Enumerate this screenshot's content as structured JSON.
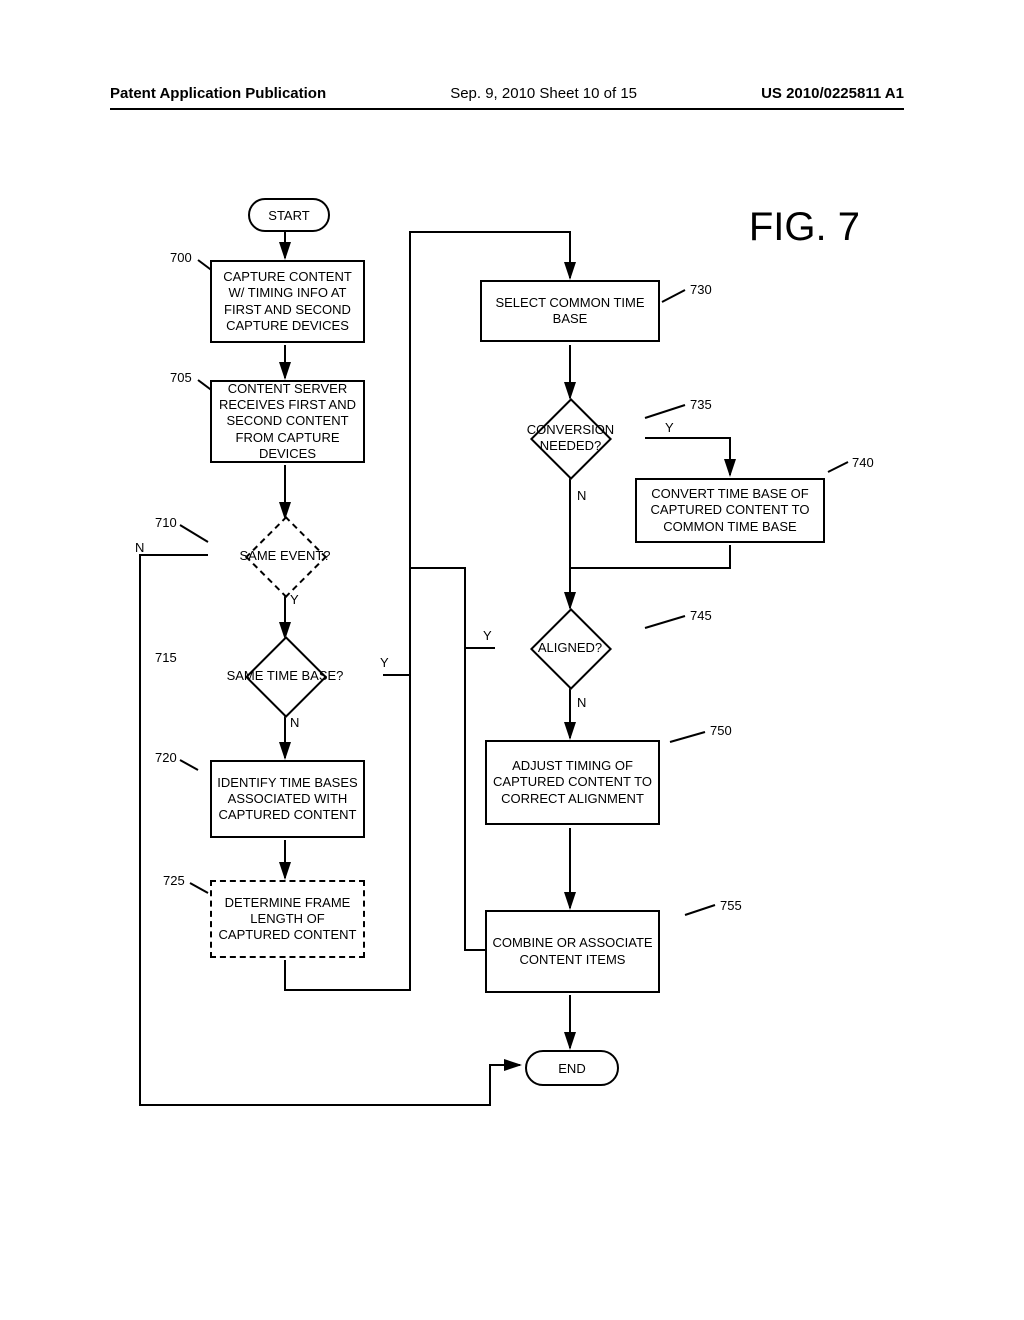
{
  "header": {
    "left": "Patent Application Publication",
    "center": "Sep. 9, 2010  Sheet 10 of 15",
    "right": "US 2010/0225811 A1"
  },
  "figure": {
    "title": "FIG. 7"
  },
  "nodes": {
    "start": "START",
    "n700": "CAPTURE CONTENT W/ TIMING INFO AT FIRST AND SECOND CAPTURE DEVICES",
    "n705": "CONTENT SERVER RECEIVES FIRST AND SECOND CONTENT FROM CAPTURE DEVICES",
    "n710": "SAME EVENT?",
    "n715": "SAME TIME BASE?",
    "n720": "IDENTIFY TIME BASES ASSOCIATED WITH CAPTURED CONTENT",
    "n725": "DETERMINE FRAME LENGTH OF CAPTURED CONTENT",
    "n730": "SELECT COMMON TIME BASE",
    "n735": "CONVERSION NEEDED?",
    "n740": "CONVERT TIME BASE OF CAPTURED CONTENT TO COMMON TIME BASE",
    "n745": "ALIGNED?",
    "n750": "ADJUST TIMING OF CAPTURED CONTENT TO CORRECT ALIGNMENT",
    "n755": "COMBINE OR ASSOCIATE CONTENT ITEMS",
    "end": "END"
  },
  "refs": {
    "r700": "700",
    "r705": "705",
    "r710": "710",
    "r715": "715",
    "r720": "720",
    "r725": "725",
    "r730": "730",
    "r735": "735",
    "r740": "740",
    "r745": "745",
    "r750": "750",
    "r755": "755"
  },
  "branches": {
    "y": "Y",
    "n": "N"
  }
}
